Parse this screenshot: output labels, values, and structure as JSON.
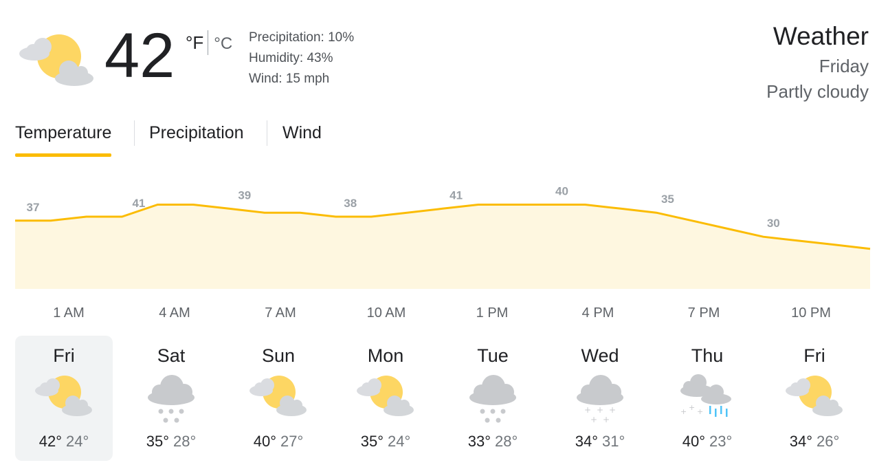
{
  "current": {
    "icon": "partly-cloudy-icon",
    "temp": "42",
    "unit_f": "°F",
    "unit_c": "°C",
    "precipitation": "Precipitation: 10%",
    "humidity": "Humidity: 43%",
    "wind": "Wind: 15 mph"
  },
  "header": {
    "title": "Weather",
    "day": "Friday",
    "condition": "Partly cloudy"
  },
  "tabs": [
    {
      "label": "Temperature",
      "active": true
    },
    {
      "label": "Precipitation",
      "active": false
    },
    {
      "label": "Wind",
      "active": false
    }
  ],
  "colors": {
    "accent": "#fbbc04",
    "area_fill": "#fef7e0",
    "label_gray": "#9aa0a6",
    "selected_bg": "#f1f3f4",
    "rain_blue": "#4fc3f7"
  },
  "chart_data": {
    "type": "area",
    "series": [
      {
        "values": [
          37,
          37,
          38,
          38,
          41,
          41,
          40,
          39,
          39,
          38,
          38,
          39,
          40,
          41,
          41,
          41,
          41,
          40,
          39,
          37,
          35,
          33,
          32,
          31,
          30
        ]
      }
    ],
    "labels": [
      {
        "index": 0,
        "value": "37"
      },
      {
        "index": 3,
        "value": "41"
      },
      {
        "index": 6,
        "value": "39"
      },
      {
        "index": 9,
        "value": "38"
      },
      {
        "index": 12,
        "value": "41"
      },
      {
        "index": 15,
        "value": "40"
      },
      {
        "index": 18,
        "value": "35"
      },
      {
        "index": 21,
        "value": "30"
      }
    ],
    "x_tick_labels": [
      "1 AM",
      "4 AM",
      "7 AM",
      "10 AM",
      "1 PM",
      "4 PM",
      "7 PM",
      "10 PM"
    ],
    "ylim": [
      20,
      44
    ],
    "grid": false
  },
  "days": [
    {
      "name": "Fri",
      "icon": "partly-cloudy-icon",
      "hi": "42°",
      "lo": "24°",
      "selected": true
    },
    {
      "name": "Sat",
      "icon": "snow-icon",
      "hi": "35°",
      "lo": "28°",
      "selected": false
    },
    {
      "name": "Sun",
      "icon": "partly-cloudy-icon",
      "hi": "40°",
      "lo": "27°",
      "selected": false
    },
    {
      "name": "Mon",
      "icon": "partly-cloudy-icon",
      "hi": "35°",
      "lo": "24°",
      "selected": false
    },
    {
      "name": "Tue",
      "icon": "snow-icon",
      "hi": "33°",
      "lo": "28°",
      "selected": false
    },
    {
      "name": "Wed",
      "icon": "light-snow-icon",
      "hi": "34°",
      "lo": "31°",
      "selected": false
    },
    {
      "name": "Thu",
      "icon": "rain-snow-icon",
      "hi": "40°",
      "lo": "23°",
      "selected": false
    },
    {
      "name": "Fri",
      "icon": "partly-cloudy-icon",
      "hi": "34°",
      "lo": "26°",
      "selected": false
    }
  ]
}
